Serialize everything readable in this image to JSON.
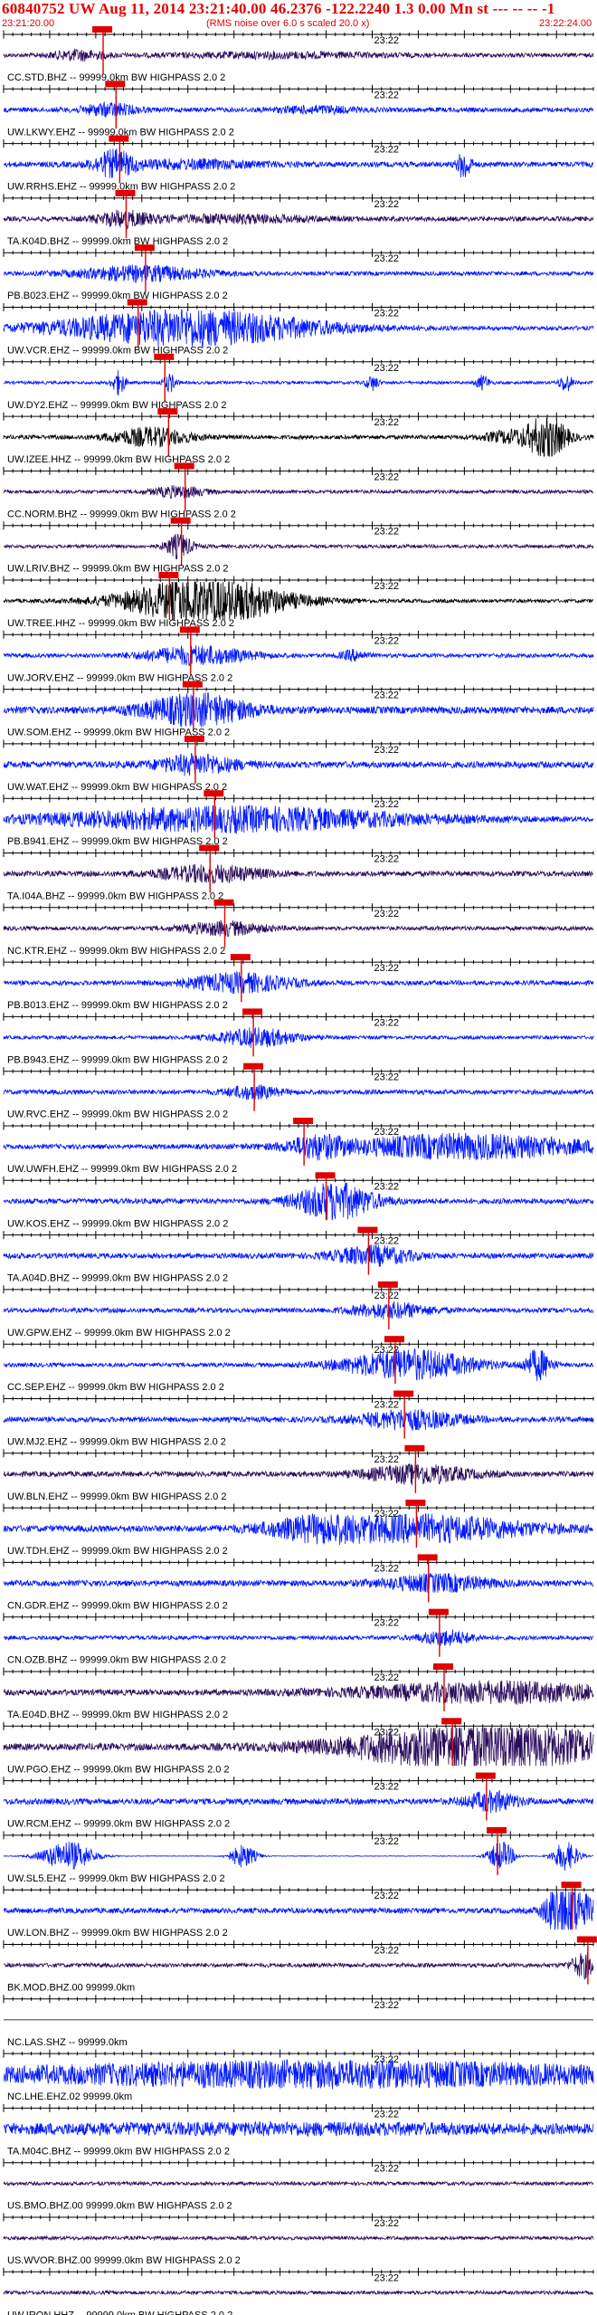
{
  "header": {
    "title": "60840752 UW Aug 11, 2014 23:21:40.00   46.2376 -122.2240  1.3 0.00 Mn st --- -- --  -1",
    "time_start": "23:21:20.00",
    "rms_note": "(RMS noise over 6.0 s scaled 20.0 x)",
    "time_end": "23:22:24.00"
  },
  "colors": {
    "blue": "#0018ff",
    "purple": "#2a0c5c",
    "black": "#000000",
    "pick": "#e00000"
  },
  "chart_data": {
    "type": "line",
    "title": "60840752 UW Aug 11, 2014 23:21:40.00",
    "time_range": [
      "23:21:20.00",
      "23:22:24.00"
    ],
    "minute_label": "23:22",
    "traces": [
      {
        "label": "CC.STD.BHZ -- 99999.0km BW HIGHPASS 2.0 2",
        "color": "purple",
        "amp": 0.35,
        "pick": 10.8,
        "events": [
          [
            8.0,
            2.0,
            0.8
          ],
          [
            30,
            8,
            0.4
          ]
        ]
      },
      {
        "label": "UW.LKWY.EHZ -- 99999.0km BW HIGHPASS 2.0 2",
        "color": "blue",
        "amp": 0.4,
        "pick": 12.2,
        "events": [
          [
            11.5,
            2.0,
            1.0
          ],
          [
            34,
            3,
            0.5
          ]
        ]
      },
      {
        "label": "UW.RRHS.EHZ -- 99999.0km BW HIGHPASS 2.0 2",
        "color": "blue",
        "amp": 0.45,
        "pick": 12.6,
        "events": [
          [
            12.0,
            1.5,
            2.0
          ],
          [
            20,
            6,
            0.6
          ],
          [
            50,
            0.5,
            2.5
          ]
        ]
      },
      {
        "label": "TA.K04D.BHZ -- 99999.0km BW HIGHPASS 2.0 2",
        "color": "purple",
        "amp": 0.4,
        "pick": 13.3,
        "events": [
          [
            13.0,
            2.0,
            1.2
          ],
          [
            25,
            6,
            0.6
          ]
        ]
      },
      {
        "label": "PB.B023.EHZ -- 99999.0km BW HIGHPASS 2.0 2",
        "color": "blue",
        "amp": 0.35,
        "pick": 15.4,
        "events": [
          [
            15.0,
            5.0,
            1.2
          ]
        ]
      },
      {
        "label": "UW.VCR.EHZ -- 99999.0km BW HIGHPASS 2.0 2",
        "color": "blue",
        "amp": 0.35,
        "pick": 14.6,
        "events": [
          [
            20,
            10,
            3.0
          ]
        ]
      },
      {
        "label": "UW.DY2.EHZ -- 99999.0km BW HIGHPASS 2.0 2",
        "color": "blue",
        "amp": 0.25,
        "pick": 17.5,
        "events": [
          [
            12.5,
            0.5,
            2.0
          ],
          [
            18,
            0.5,
            1.5
          ],
          [
            40,
            0.5,
            1.2
          ],
          [
            52,
            0.5,
            1.2
          ],
          [
            61,
            0.5,
            1.5
          ]
        ]
      },
      {
        "label": "UW.IZEE.HHZ -- 99999.0km BW HIGHPASS 2.0 2",
        "color": "black",
        "amp": 0.35,
        "pick": 17.9,
        "events": [
          [
            16,
            3,
            1.5
          ],
          [
            59,
            1.5,
            3.5
          ],
          [
            55,
            2,
            1.0
          ]
        ]
      },
      {
        "label": "CC.NORM.BHZ -- 99999.0km BW HIGHPASS 2.0 2",
        "color": "purple",
        "amp": 0.3,
        "pick": 19.7,
        "events": [
          [
            19,
            2,
            0.9
          ]
        ]
      },
      {
        "label": "UW.LRIV.BHZ -- 99999.0km BW HIGHPASS 2.0 2",
        "color": "purple",
        "amp": 0.3,
        "pick": 19.3,
        "events": [
          [
            19,
            1,
            2.0
          ]
        ]
      },
      {
        "label": "UW.TREE.HHZ -- 99999.0km BW HIGHPASS 2.0 2",
        "color": "black",
        "amp": 0.3,
        "pick": 18.0,
        "events": [
          [
            22,
            6,
            4.0
          ]
        ]
      },
      {
        "label": "UW.JORV.EHZ -- 99999.0km BW HIGHPASS 2.0 2",
        "color": "blue",
        "amp": 0.35,
        "pick": 20.3,
        "events": [
          [
            21,
            4,
            1.5
          ],
          [
            38,
            1,
            0.8
          ]
        ]
      },
      {
        "label": "UW.SOM.EHZ -- 99999.0km BW HIGHPASS 2.0 2",
        "color": "blue",
        "amp": 0.6,
        "pick": 20.6,
        "events": [
          [
            21,
            4,
            2.5
          ]
        ]
      },
      {
        "label": "UW.WAT.EHZ -- 99999.0km BW HIGHPASS 2.0 2",
        "color": "blue",
        "amp": 0.55,
        "pick": 20.8,
        "events": [
          [
            21,
            3,
            1.5
          ]
        ]
      },
      {
        "label": "PB.B941.EHZ -- 99999.0km BW HIGHPASS 2.0 2",
        "color": "blue",
        "amp": 0.4,
        "pick": 22.9,
        "events": [
          [
            25,
            14,
            2.0
          ]
        ]
      },
      {
        "label": "TA.I04A.BHZ -- 99999.0km BW HIGHPASS 2.0 2",
        "color": "purple",
        "amp": 0.45,
        "pick": 22.4,
        "events": [
          [
            22.5,
            4,
            1.3
          ]
        ]
      },
      {
        "label": "NC.KTR.EHZ -- 99999.0km BW HIGHPASS 2.0 2",
        "color": "purple",
        "amp": 0.35,
        "pick": 24.0,
        "events": [
          [
            24,
            3,
            1.1
          ]
        ]
      },
      {
        "label": "PB.B013.EHZ -- 99999.0km BW HIGHPASS 2.0 2",
        "color": "blue",
        "amp": 0.4,
        "pick": 25.8,
        "events": [
          [
            25.5,
            4,
            1.5
          ]
        ]
      },
      {
        "label": "PB.B943.EHZ -- 99999.0km BW HIGHPASS 2.0 2",
        "color": "blue",
        "amp": 0.3,
        "pick": 27.1,
        "events": [
          [
            27.5,
            3,
            1.5
          ]
        ]
      },
      {
        "label": "UW.RVC.EHZ -- 99999.0km BW HIGHPASS 2.0 2",
        "color": "blue",
        "amp": 0.4,
        "pick": 27.2,
        "events": [
          [
            27,
            2,
            1.0
          ]
        ]
      },
      {
        "label": "UW.UWFH.EHZ -- 99999.0km BW HIGHPASS 2.0 2",
        "color": "blue",
        "amp": 0.4,
        "pick": 32.6,
        "events": [
          [
            34,
            2,
            1.5
          ],
          [
            50,
            10,
            2.0
          ]
        ]
      },
      {
        "label": "UW.KOS.EHZ -- 99999.0km BW HIGHPASS 2.0 2",
        "color": "blue",
        "amp": 0.45,
        "pick": 35.0,
        "events": [
          [
            36,
            3,
            3.0
          ]
        ]
      },
      {
        "label": "TA.A04D.BHZ -- 99999.0km BW HIGHPASS 2.0 2",
        "color": "blue",
        "amp": 0.45,
        "pick": 39.6,
        "events": [
          [
            40,
            3,
            1.5
          ]
        ]
      },
      {
        "label": "UW.GPW.EHZ -- 99999.0km BW HIGHPASS 2.0 2",
        "color": "blue",
        "amp": 0.4,
        "pick": 41.8,
        "events": [
          [
            42,
            3,
            1.2
          ]
        ]
      },
      {
        "label": "CC.SEP.EHZ -- 99999.0km BW HIGHPASS 2.0 2",
        "color": "blue",
        "amp": 0.35,
        "pick": 42.5,
        "events": [
          [
            44,
            5,
            2.5
          ],
          [
            58,
            1,
            2.5
          ]
        ]
      },
      {
        "label": "UW.MJ2.EHZ -- 99999.0km BW HIGHPASS 2.0 2",
        "color": "blue",
        "amp": 0.45,
        "pick": 43.5,
        "events": [
          [
            44,
            4,
            1.5
          ]
        ]
      },
      {
        "label": "UW.BLN.EHZ -- 99999.0km BW HIGHPASS 2.0 2",
        "color": "purple",
        "amp": 0.45,
        "pick": 44.7,
        "events": [
          [
            45,
            4,
            1.5
          ]
        ]
      },
      {
        "label": "UW.TDH.EHZ -- 99999.0km BW HIGHPASS 2.0 2",
        "color": "blue",
        "amp": 0.55,
        "pick": 44.8,
        "events": [
          [
            46,
            8,
            2.0
          ],
          [
            34,
            4,
            1.5
          ]
        ]
      },
      {
        "label": "CN.GDR.EHZ -- 99999.0km BW HIGHPASS 2.0 2",
        "color": "blue",
        "amp": 0.5,
        "pick": 46.1,
        "events": [
          [
            47,
            4,
            1.3
          ]
        ]
      },
      {
        "label": "CN.OZB.BHZ -- 99999.0km BW HIGHPASS 2.0 2",
        "color": "blue",
        "amp": 0.35,
        "pick": 47.3,
        "events": [
          [
            48,
            2,
            1.2
          ]
        ]
      },
      {
        "label": "TA.E04D.BHZ -- 99999.0km BW HIGHPASS 2.0 2",
        "color": "purple",
        "amp": 0.5,
        "pick": 47.8,
        "events": [
          [
            53,
            10,
            1.6
          ]
        ]
      },
      {
        "label": "UW.PGO.EHZ -- 99999.0km BW HIGHPASS 2.0 2",
        "color": "purple",
        "amp": 0.6,
        "pick": 48.7,
        "events": [
          [
            52,
            10,
            4.0
          ]
        ]
      },
      {
        "label": "UW.RCM.EHZ -- 99999.0km BW HIGHPASS 2.0 2",
        "color": "blue",
        "amp": 0.5,
        "pick": 52.4,
        "events": [
          [
            53,
            2,
            1.5
          ]
        ]
      },
      {
        "label": "UW.SL5.EHZ -- 99999.0km BW HIGHPASS 2.0 2",
        "color": "blue",
        "amp": 0.05,
        "pick": 53.6,
        "events": [
          [
            7,
            2,
            2.5
          ],
          [
            26,
            1,
            2.0
          ],
          [
            54,
            1,
            2.5
          ],
          [
            61,
            1,
            2.5
          ]
        ]
      },
      {
        "label": "UW.LON.BHZ -- 99999.0km BW HIGHPASS 2.0 2",
        "color": "blue",
        "amp": 0.45,
        "pick": 61.7,
        "events": [
          [
            60,
            1,
            3.0
          ],
          [
            62,
            1.5,
            3.5
          ]
        ]
      },
      {
        "label": "BK.MOD.BHZ.00 99999.0km",
        "color": "purple",
        "amp": 0.35,
        "pick": 63.4,
        "events": [
          [
            63,
            1,
            2.0
          ]
        ]
      },
      {
        "label": "NC.LAS.SHZ -- 99999.0km",
        "color": "purple",
        "amp": 0,
        "pick": null,
        "events": []
      },
      {
        "label": "NC.LHE.EHZ.02 99999.0km",
        "color": "blue",
        "amp": 0.55,
        "pick": null,
        "events": [
          [
            35,
            28,
            2.0
          ]
        ]
      },
      {
        "label": "TA.M04C.BHZ -- 99999.0km BW HIGHPASS 2.0 2",
        "color": "blue",
        "amp": 0.45,
        "pick": null,
        "events": [
          [
            30,
            30,
            0.8
          ]
        ]
      },
      {
        "label": "US.BMO.BHZ.00 99999.0km BW HIGHPASS 2.0 2",
        "color": "purple",
        "amp": 0.3,
        "pick": null,
        "events": []
      },
      {
        "label": "US.WVOR.BHZ.00 99999.0km BW HIGHPASS 2.0 2",
        "color": "purple",
        "amp": 0.3,
        "pick": null,
        "events": []
      },
      {
        "label": "UW.IRON.HHZ -- 99999.0km BW HIGHPASS 2.0 2",
        "color": "purple",
        "amp": 0.3,
        "pick": null,
        "events": []
      },
      {
        "label": "",
        "color": "purple",
        "amp": 0.3,
        "pick": null,
        "events": []
      }
    ]
  }
}
